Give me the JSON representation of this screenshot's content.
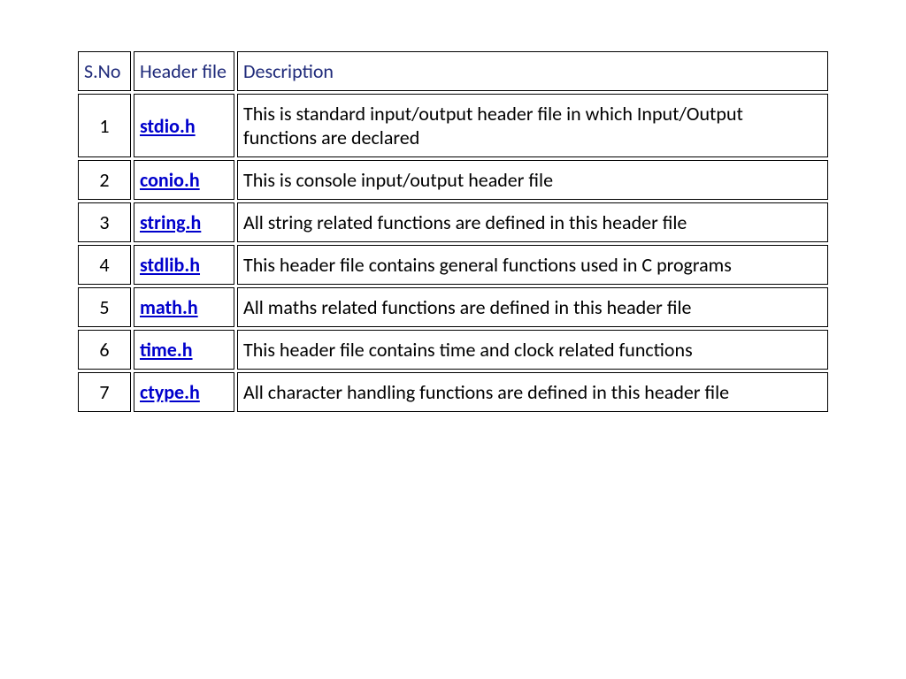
{
  "table": {
    "headers": {
      "sno": "S.No",
      "header_file": "Header file",
      "description": "Description"
    },
    "rows": [
      {
        "sno": "1",
        "header_file": "stdio.h",
        "description": "This is standard input/output header file in which Input/Output\nfunctions are declared"
      },
      {
        "sno": "2",
        "header_file": "conio.h",
        "description": "This is console input/output header file"
      },
      {
        "sno": "3",
        "header_file": "string.h",
        "description": "All string related functions are defined in this header file"
      },
      {
        "sno": "4",
        "header_file": "stdlib.h",
        "description": "This header file contains general functions used in C programs"
      },
      {
        "sno": "5",
        "header_file": "math.h",
        "description": "All maths related functions are defined in this header file"
      },
      {
        "sno": "6",
        "header_file": "time.h",
        "description": "This header file contains time and clock related functions"
      },
      {
        "sno": "7",
        "header_file": "ctype.h",
        "description": "All character handling functions are defined in this header file"
      }
    ]
  }
}
